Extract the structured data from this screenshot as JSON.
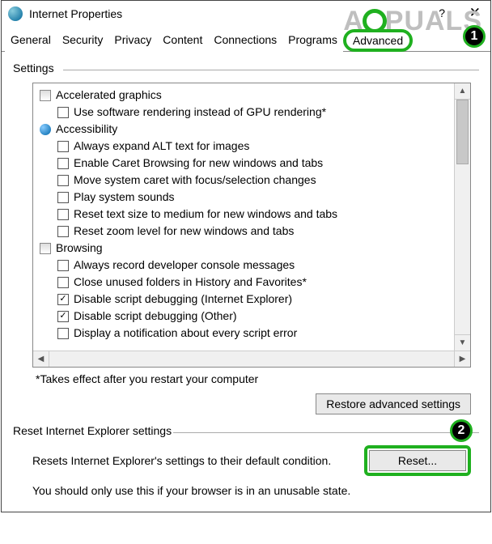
{
  "window": {
    "title": "Internet Properties",
    "help": "?",
    "close": "✕"
  },
  "tabs": {
    "items": [
      "General",
      "Security",
      "Privacy",
      "Content",
      "Connections",
      "Programs",
      "Advanced"
    ],
    "active": 6
  },
  "annotations": {
    "step1": "1",
    "step2": "2"
  },
  "settings": {
    "group_label": "Settings",
    "categories": [
      {
        "icon": "sq",
        "label": "Accelerated graphics",
        "items": [
          {
            "checked": false,
            "label": "Use software rendering instead of GPU rendering*"
          }
        ]
      },
      {
        "icon": "globe",
        "label": "Accessibility",
        "items": [
          {
            "checked": false,
            "label": "Always expand ALT text for images"
          },
          {
            "checked": false,
            "label": "Enable Caret Browsing for new windows and tabs"
          },
          {
            "checked": false,
            "label": "Move system caret with focus/selection changes"
          },
          {
            "checked": false,
            "label": "Play system sounds"
          },
          {
            "checked": false,
            "label": "Reset text size to medium for new windows and tabs"
          },
          {
            "checked": false,
            "label": "Reset zoom level for new windows and tabs"
          }
        ]
      },
      {
        "icon": "sq",
        "label": "Browsing",
        "items": [
          {
            "checked": false,
            "label": "Always record developer console messages"
          },
          {
            "checked": false,
            "label": "Close unused folders in History and Favorites*"
          },
          {
            "checked": true,
            "label": "Disable script debugging (Internet Explorer)"
          },
          {
            "checked": true,
            "label": "Disable script debugging (Other)"
          },
          {
            "checked": false,
            "label": "Display a notification about every script error"
          }
        ]
      }
    ],
    "footnote": "*Takes effect after you restart your computer",
    "restore_button": "Restore advanced settings"
  },
  "reset": {
    "group_label": "Reset Internet Explorer settings",
    "description": "Resets Internet Explorer's settings to their default condition.",
    "button": "Reset...",
    "warning": "You should only use this if your browser is in an unusable state."
  },
  "watermark": {
    "pre": "A",
    "post": "PUALS"
  }
}
